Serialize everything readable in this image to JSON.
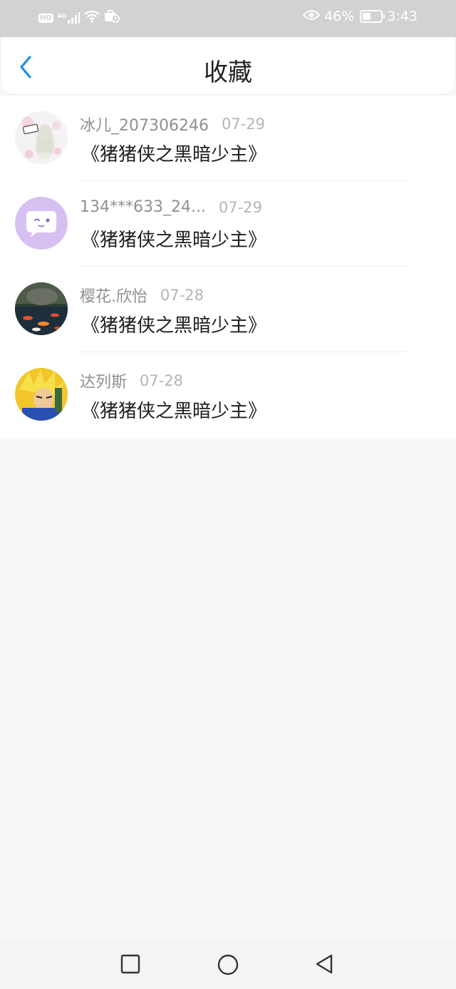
{
  "status_bar": {
    "hd": "HD",
    "signal": "4G",
    "battery_percent": "46%",
    "battery_level": 0.46,
    "time": "3:43",
    "icons": [
      "hd-icon",
      "signal-icon",
      "wifi-icon",
      "work-profile-icon",
      "eye-icon",
      "battery-icon"
    ]
  },
  "header": {
    "title": "收藏",
    "back_icon": "chevron-left-icon",
    "accent": "#1a8fe3"
  },
  "favorites": [
    {
      "user": "冰儿_207306246",
      "date": "07-29",
      "book": "《猪猪侠之黑暗少主》",
      "avatar": "anime-girl-avatar"
    },
    {
      "user": "134***633_24...",
      "date": "07-29",
      "book": "《猪猪侠之黑暗少主》",
      "avatar": "purple-chat-avatar"
    },
    {
      "user": "樱花.欣怡",
      "date": "07-28",
      "book": "《猪猪侠之黑暗少主》",
      "avatar": "koi-pond-avatar"
    },
    {
      "user": "达列斯",
      "date": "07-28",
      "book": "《猪猪侠之黑暗少主》",
      "avatar": "anime-warrior-avatar"
    }
  ],
  "nav_bar": {
    "icons": [
      "square-recents-icon",
      "circle-home-icon",
      "triangle-back-icon"
    ]
  }
}
